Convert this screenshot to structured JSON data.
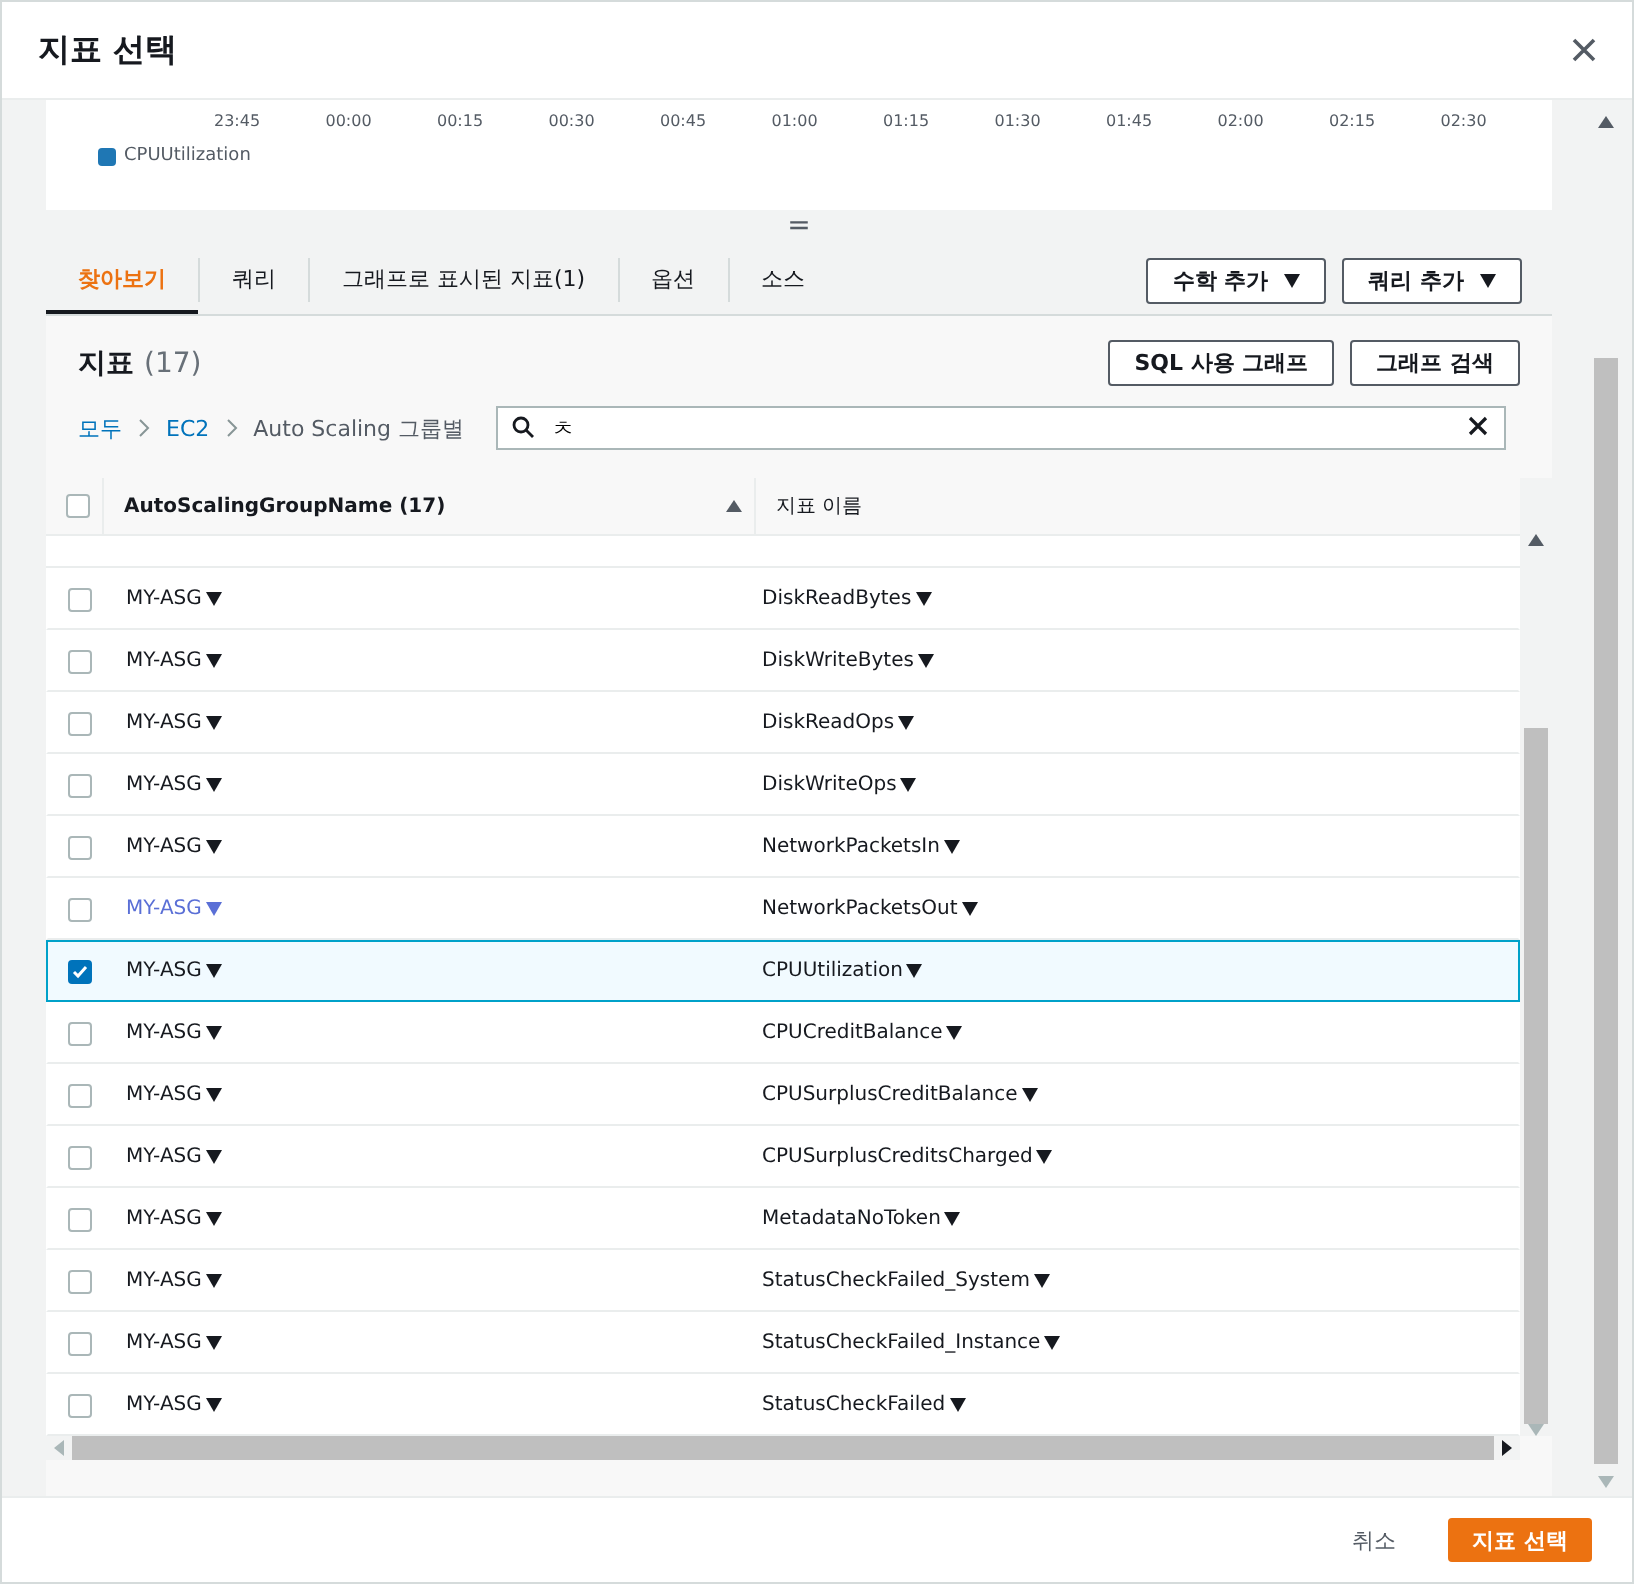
{
  "dialog": {
    "title": "지표 선택"
  },
  "graph": {
    "time_labels": [
      "23:45",
      "00:00",
      "00:15",
      "00:30",
      "00:45",
      "01:00",
      "01:15",
      "01:30",
      "01:45",
      "02:00",
      "02:15",
      "02:30"
    ],
    "legend": [
      {
        "label": "CPUUtilization",
        "color": "#1f77b4"
      }
    ]
  },
  "splitter": "=",
  "tabs": [
    {
      "label": "찾아보기",
      "selected": true
    },
    {
      "label": "쿼리",
      "selected": false
    },
    {
      "label": "그래프로 표시된 지표(1)",
      "selected": false
    },
    {
      "label": "옵션",
      "selected": false
    },
    {
      "label": "소스",
      "selected": false
    }
  ],
  "tab_buttons": [
    "수학 추가",
    "쿼리 추가"
  ],
  "metrics": {
    "title": "지표",
    "count": "(17)",
    "buttons": [
      "SQL 사용 그래프",
      "그래프 검색"
    ]
  },
  "breadcrumbs": [
    {
      "label": "모두",
      "link": true
    },
    {
      "label": "EC2",
      "link": true
    },
    {
      "label": "Auto Scaling 그룹별",
      "link": false
    }
  ],
  "search": {
    "value": "ㅊ"
  },
  "table": {
    "all_checked": false,
    "columns": [
      "AutoScalingGroupName (17)",
      "지표 이름"
    ],
    "rows": [
      {
        "group": "MY-ASG",
        "metric": "DiskReadBytes",
        "checked": false,
        "hovered": false
      },
      {
        "group": "MY-ASG",
        "metric": "DiskWriteBytes",
        "checked": false,
        "hovered": false
      },
      {
        "group": "MY-ASG",
        "metric": "DiskReadOps",
        "checked": false,
        "hovered": false
      },
      {
        "group": "MY-ASG",
        "metric": "DiskWriteOps",
        "checked": false,
        "hovered": false
      },
      {
        "group": "MY-ASG",
        "metric": "NetworkPacketsIn",
        "checked": false,
        "hovered": false
      },
      {
        "group": "MY-ASG",
        "metric": "NetworkPacketsOut",
        "checked": false,
        "hovered": true
      },
      {
        "group": "MY-ASG",
        "metric": "CPUUtilization",
        "checked": true,
        "hovered": false
      },
      {
        "group": "MY-ASG",
        "metric": "CPUCreditBalance",
        "checked": false,
        "hovered": false
      },
      {
        "group": "MY-ASG",
        "metric": "CPUSurplusCreditBalance",
        "checked": false,
        "hovered": false
      },
      {
        "group": "MY-ASG",
        "metric": "CPUSurplusCreditsCharged",
        "checked": false,
        "hovered": false
      },
      {
        "group": "MY-ASG",
        "metric": "MetadataNoToken",
        "checked": false,
        "hovered": false
      },
      {
        "group": "MY-ASG",
        "metric": "StatusCheckFailed_System",
        "checked": false,
        "hovered": false
      },
      {
        "group": "MY-ASG",
        "metric": "StatusCheckFailed_Instance",
        "checked": false,
        "hovered": false
      },
      {
        "group": "MY-ASG",
        "metric": "StatusCheckFailed",
        "checked": false,
        "hovered": false
      }
    ]
  },
  "footer": {
    "cancel": "취소",
    "confirm": "지표 선택"
  }
}
